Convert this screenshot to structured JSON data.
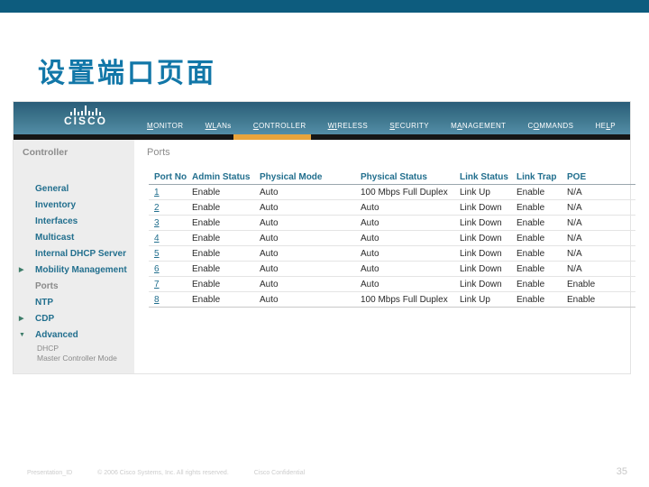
{
  "slide": {
    "title": "设置端口页面",
    "footer": {
      "presentation_id": "Presentation_ID",
      "copyright": "© 2006 Cisco Systems, Inc. All rights reserved.",
      "confidential": "Cisco Confidential",
      "page_number": "35"
    }
  },
  "app": {
    "brand": "CISCO",
    "nav_items": [
      {
        "pre": "",
        "u": "M",
        "post": "ONITOR",
        "active": false
      },
      {
        "pre": "",
        "u": "WL",
        "post": "ANs",
        "active": false
      },
      {
        "pre": "",
        "u": "C",
        "post": "ONTROLLER",
        "active": true
      },
      {
        "pre": "",
        "u": "WI",
        "post": "RELESS",
        "active": false
      },
      {
        "pre": "",
        "u": "S",
        "post": "ECURITY",
        "active": false
      },
      {
        "pre": "M",
        "u": "A",
        "post": "NAGEMENT",
        "active": false
      },
      {
        "pre": "C",
        "u": "O",
        "post": "MMANDS",
        "active": false
      },
      {
        "pre": "HE",
        "u": "L",
        "post": "P",
        "active": false
      }
    ],
    "sidebar": {
      "heading": "Controller",
      "items": [
        {
          "label": "General",
          "type": "link",
          "arrow": null
        },
        {
          "label": "Inventory",
          "type": "link",
          "arrow": null
        },
        {
          "label": "Interfaces",
          "type": "link",
          "arrow": null
        },
        {
          "label": "Multicast",
          "type": "link",
          "arrow": null
        },
        {
          "label": "Internal DHCP Server",
          "type": "link",
          "arrow": null
        },
        {
          "label": "Mobility Management",
          "type": "link",
          "arrow": "right"
        },
        {
          "label": "Ports",
          "type": "current",
          "arrow": null
        },
        {
          "label": "NTP",
          "type": "link",
          "arrow": null
        },
        {
          "label": "CDP",
          "type": "link",
          "arrow": "right"
        },
        {
          "label": "Advanced",
          "type": "link",
          "arrow": "down"
        },
        {
          "label": "DHCP",
          "type": "sub",
          "arrow": null
        },
        {
          "label": "Master Controller Mode",
          "type": "sub",
          "arrow": null
        }
      ]
    },
    "page": {
      "title": "Ports",
      "table": {
        "columns": [
          "Port No",
          "Admin Status",
          "Physical Mode",
          "Physical Status",
          "Link Status",
          "Link Trap",
          "POE"
        ],
        "rows": [
          [
            "1",
            "Enable",
            "Auto",
            "100 Mbps Full Duplex",
            "Link Up",
            "Enable",
            "N/A"
          ],
          [
            "2",
            "Enable",
            "Auto",
            "Auto",
            "Link Down",
            "Enable",
            "N/A"
          ],
          [
            "3",
            "Enable",
            "Auto",
            "Auto",
            "Link Down",
            "Enable",
            "N/A"
          ],
          [
            "4",
            "Enable",
            "Auto",
            "Auto",
            "Link Down",
            "Enable",
            "N/A"
          ],
          [
            "5",
            "Enable",
            "Auto",
            "Auto",
            "Link Down",
            "Enable",
            "N/A"
          ],
          [
            "6",
            "Enable",
            "Auto",
            "Auto",
            "Link Down",
            "Enable",
            "N/A"
          ],
          [
            "7",
            "Enable",
            "Auto",
            "Auto",
            "Link Down",
            "Enable",
            "Enable"
          ],
          [
            "8",
            "Enable",
            "Auto",
            "100 Mbps Full Duplex",
            "Link Up",
            "Enable",
            "Enable"
          ]
        ]
      }
    }
  },
  "colors": {
    "slide_bar": "#0d5c7e",
    "title_blue": "#1277a8",
    "nav_teal_top": "#2a5d79",
    "nav_teal_bottom": "#538da7",
    "active_orange": "#e9a43c",
    "link_teal": "#226f8e",
    "sidebar_gray": "#ededed"
  }
}
